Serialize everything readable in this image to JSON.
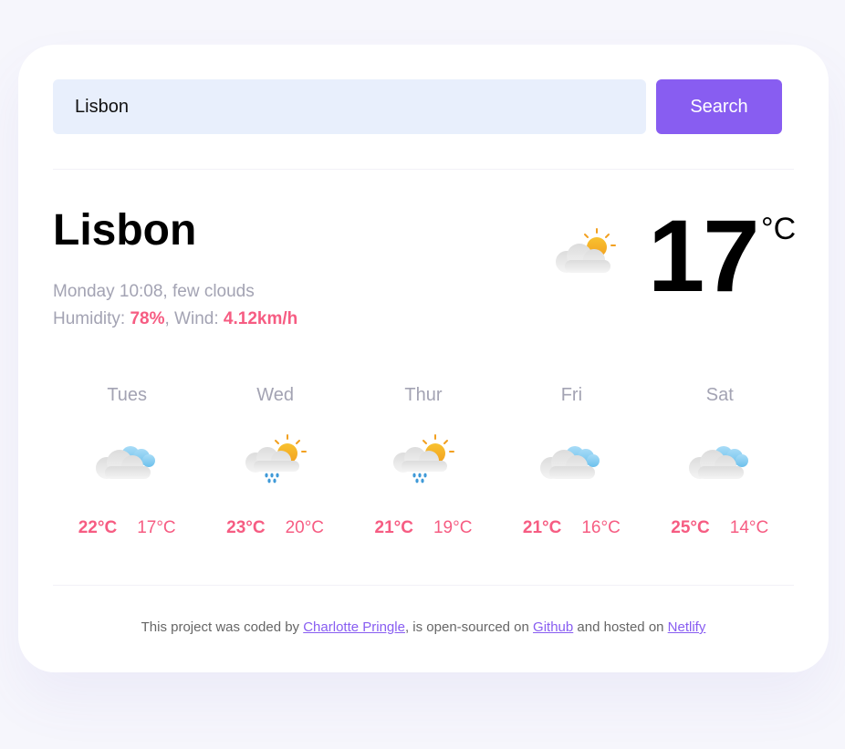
{
  "search": {
    "value": "Lisbon",
    "button_label": "Search"
  },
  "current": {
    "city": "Lisbon",
    "datetime_desc": "Monday 10:08, few clouds",
    "humidity_label": "Humidity: ",
    "humidity_value": "78%",
    "wind_label": ", Wind: ",
    "wind_value": "4.12km/h",
    "temperature": "17",
    "unit": "°C",
    "icon": "few-clouds-icon"
  },
  "forecast": [
    {
      "day": "Tues",
      "max": "22°C",
      "min": "17°C",
      "icon": "cloudy-icon"
    },
    {
      "day": "Wed",
      "max": "23°C",
      "min": "20°C",
      "icon": "rain-sun-icon"
    },
    {
      "day": "Thur",
      "max": "21°C",
      "min": "19°C",
      "icon": "rain-sun-icon"
    },
    {
      "day": "Fri",
      "max": "21°C",
      "min": "16°C",
      "icon": "cloudy-icon"
    },
    {
      "day": "Sat",
      "max": "25°C",
      "min": "14°C",
      "icon": "cloudy-icon"
    }
  ],
  "footer": {
    "text1": "This project was coded by ",
    "author": "Charlotte Pringle",
    "text2": ", is open-sourced on ",
    "github": "Github",
    "text3": " and hosted on ",
    "netlify": "Netlify"
  },
  "colors": {
    "accent": "#885df1",
    "temp_accent": "#f65c82",
    "muted": "#a3a3b3",
    "input_bg": "#e8effc",
    "page_bg": "#f6f6fc"
  }
}
